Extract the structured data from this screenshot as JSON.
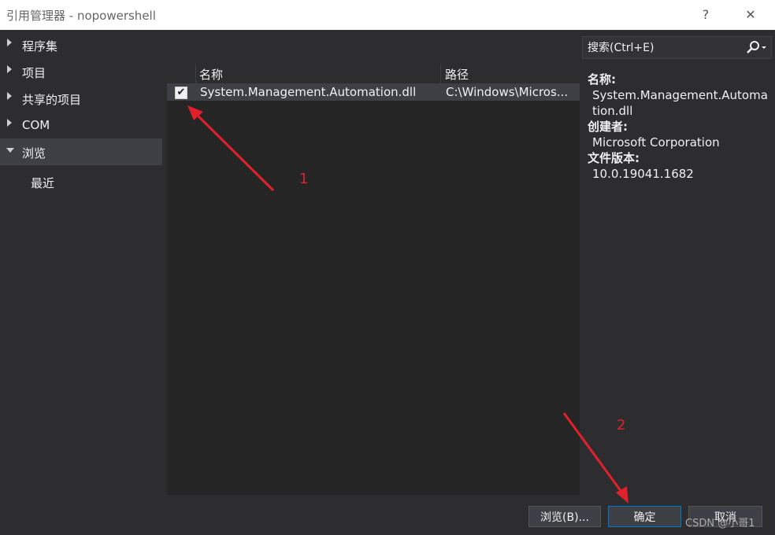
{
  "window": {
    "title": "引用管理器 - nopowershell",
    "help_label": "?",
    "close_label": "✕"
  },
  "sidebar": {
    "items": [
      {
        "label": "程序集"
      },
      {
        "label": "项目"
      },
      {
        "label": "共享的项目"
      },
      {
        "label": "COM"
      },
      {
        "label": "浏览",
        "selected": true
      }
    ],
    "subitems": [
      {
        "label": "最近"
      }
    ]
  },
  "search": {
    "placeholder": "搜索(Ctrl+E)",
    "icon": "search-icon"
  },
  "grid": {
    "columns": [
      "名称",
      "路径"
    ],
    "rows": [
      {
        "checked": true,
        "name": "System.Management.Automation.dll",
        "path": "C:\\Windows\\Micros..."
      }
    ]
  },
  "details": {
    "name_label": "名称:",
    "name_value": "System.Management.Automation.dll",
    "creator_label": "创建者:",
    "creator_value": "Microsoft Corporation",
    "version_label": "文件版本:",
    "version_value": "10.0.19041.1682"
  },
  "buttons": {
    "browse": "浏览(B)...",
    "ok": "确定",
    "cancel": "取消"
  },
  "annotations": {
    "label1": "1",
    "label2": "2",
    "color": "#e0212b"
  },
  "watermark": "CSDN @小哥1"
}
